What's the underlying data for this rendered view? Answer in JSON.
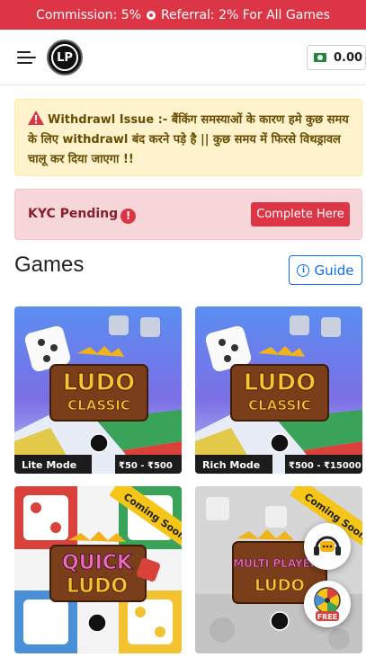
{
  "announcement": {
    "commission": "Commission: 5%",
    "referral": "Referral: 2% For All Games"
  },
  "header": {
    "logo_text": "LP",
    "wallet_balance": "0.00"
  },
  "alerts": {
    "withdrawl_title": "Withdrawl Issue :-",
    "withdrawl_body": "बैंकिंग समस्याओं के कारण हमे कुछ समय के लिए withdrawl बंद करने पड़े है || कुछ समय में फिरसे विथड्रावल चालू कर दिया जाएगा !!",
    "kyc_label": "KYC Pending",
    "kyc_button": "Complete Here"
  },
  "games": {
    "title": "Games",
    "guide_label": "Guide",
    "cards": [
      {
        "title_line1": "LUDO",
        "title_line2": "CLASSIC",
        "mode": "Lite Mode",
        "range": "₹50 - ₹500",
        "ribbon": ""
      },
      {
        "title_line1": "LUDO",
        "title_line2": "CLASSIC",
        "mode": "Rich Mode",
        "range": "₹500 - ₹15000",
        "ribbon": ""
      },
      {
        "title_line1": "QUICK",
        "title_line2": "LUDO",
        "mode": "",
        "range": "",
        "ribbon": "Coming Soon"
      },
      {
        "title_line1": "MULTI PLAYERS",
        "title_line2": "LUDO",
        "mode": "",
        "range": "",
        "ribbon": "Coming Soon"
      }
    ]
  },
  "fab": {
    "spin_label": "FREE"
  },
  "colors": {
    "danger": "#dc3545",
    "primary": "#0d6efd",
    "warning_bg": "#fff3cd",
    "danger_bg": "#f8d7da"
  }
}
